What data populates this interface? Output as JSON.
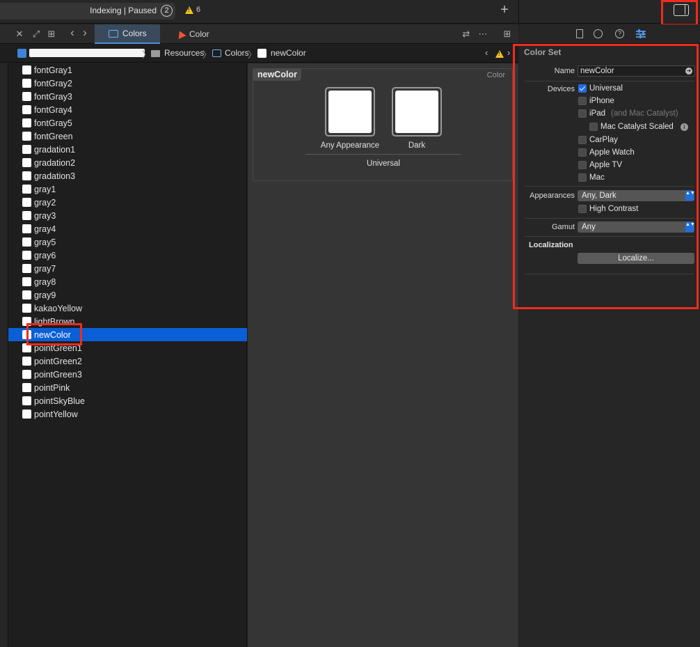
{
  "toolbar": {
    "status_text": "Indexing | Paused",
    "status_count": "2",
    "warning_count": "6",
    "add_label": "+"
  },
  "tabs": {
    "close": "✕",
    "expand": "⤢",
    "grid": "⊞",
    "back": "‹",
    "forward": "›",
    "items": [
      {
        "label": "Colors",
        "icon": "asset-catalog-icon",
        "active": true
      },
      {
        "label": "Color",
        "icon": "swift-file-icon",
        "active": false
      }
    ],
    "swap": "⇄",
    "more": "⋯",
    "split": "⊞"
  },
  "jumpbar": {
    "items": [
      "Resources",
      "Colors",
      "newColor"
    ],
    "separator": "〉",
    "prev": "‹",
    "next": "›"
  },
  "asset_list": [
    "fontGray1",
    "fontGray2",
    "fontGray3",
    "fontGray4",
    "fontGray5",
    "fontGreen",
    "gradation1",
    "gradation2",
    "gradation3",
    "gray1",
    "gray2",
    "gray3",
    "gray4",
    "gray5",
    "gray6",
    "gray7",
    "gray8",
    "gray9",
    "kakaoYellow",
    "lightBrown",
    "newColor",
    "pointGreen1",
    "pointGreen2",
    "pointGreen3",
    "pointPink",
    "pointSkyBlue",
    "pointYellow"
  ],
  "selected_asset": "newColor",
  "editor": {
    "title": "newColor",
    "type_label": "Color",
    "wells": [
      {
        "label": "Any Appearance",
        "color": "#ffffff"
      },
      {
        "label": "Dark",
        "color": "#ffffff"
      }
    ],
    "group_label": "Universal"
  },
  "inspector": {
    "section_title": "Color Set",
    "name_label": "Name",
    "name_value": "newColor",
    "devices_label": "Devices",
    "devices": [
      {
        "label": "Universal",
        "checked": true
      },
      {
        "label": "iPhone",
        "checked": false
      },
      {
        "label": "iPad",
        "note": "(and Mac Catalyst)",
        "checked": false
      },
      {
        "label": "Mac Catalyst Scaled",
        "checked": false
      },
      {
        "label": "CarPlay",
        "checked": false
      },
      {
        "label": "Apple Watch",
        "checked": false
      },
      {
        "label": "Apple TV",
        "checked": false
      },
      {
        "label": "Mac",
        "checked": false
      }
    ],
    "appearances_label": "Appearances",
    "appearances_value": "Any, Dark",
    "high_contrast_label": "High Contrast",
    "gamut_label": "Gamut",
    "gamut_value": "Any",
    "localization_title": "Localization",
    "localize_button": "Localize...",
    "help_glyph": "?",
    "info_glyph": "i",
    "popup_arrows": "▲▼",
    "go_glyph": "➜"
  },
  "colors": {
    "accent": "#0a5fd6",
    "highlight_box": "#ef2c1c",
    "warning": "#f3c21b"
  }
}
